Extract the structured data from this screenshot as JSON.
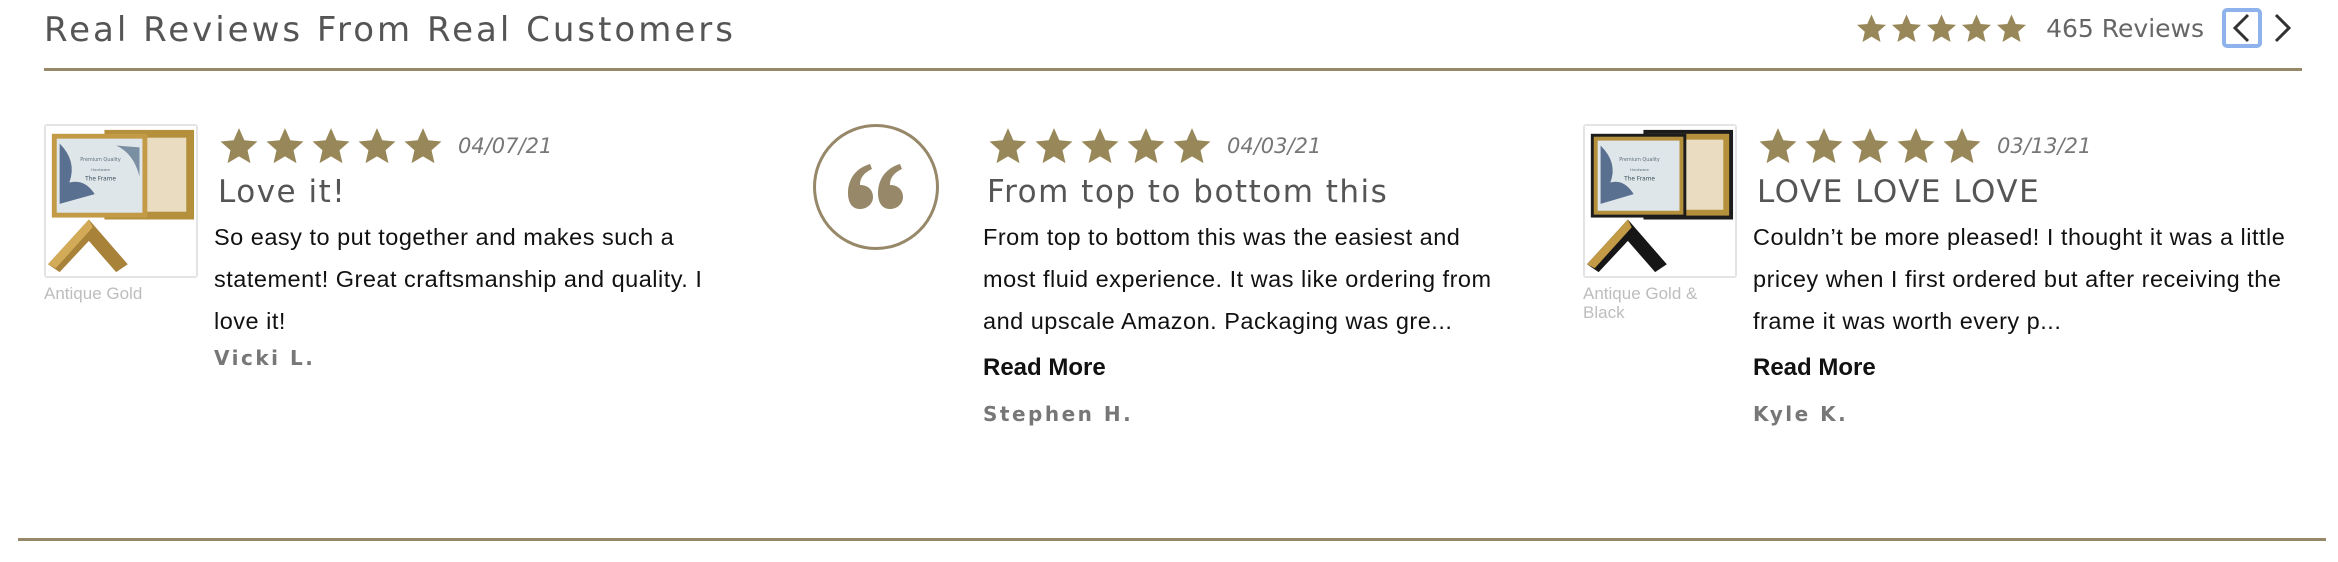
{
  "header": {
    "title": "Real Reviews From Real Customers",
    "rating_stars": 5,
    "review_count": "465 Reviews"
  },
  "reviews": [
    {
      "date": "04/07/21",
      "stars": 5,
      "title": "Love it!",
      "body": "So easy to put together and makes such a statement! Great craftsmanship and quality. I love it!",
      "read_more": "",
      "author": "Vicki L.",
      "product": "Antique Gold",
      "image_text": [
        "Premium Quality",
        "Hardware",
        "The Frame"
      ]
    },
    {
      "date": "04/03/21",
      "stars": 5,
      "title": "From top to bottom this",
      "body": "From top to bottom this was the easiest and most fluid experience. It was like ordering from and upscale Amazon. Packaging was gre...",
      "read_more": "Read More",
      "author": "Stephen H."
    },
    {
      "date": "03/13/21",
      "stars": 5,
      "title": "LOVE LOVE LOVE",
      "body": "Couldn’t be more pleased! I thought it was a little pricey when I first ordered but after receiving the frame it was worth every p...",
      "read_more": "Read More",
      "author": "Kyle K.",
      "product": "Antique Gold & Black",
      "image_text": [
        "Premium Quality",
        "Hardware",
        "The Frame"
      ]
    }
  ],
  "colors": {
    "accent": "#968868",
    "star": "#978759",
    "title_text": "#555555",
    "focus_ring": "#8eb2ec"
  },
  "icons": {
    "star": "star-icon",
    "prev": "chevron-left-icon",
    "next": "chevron-right-icon",
    "quote": "quote-icon"
  }
}
